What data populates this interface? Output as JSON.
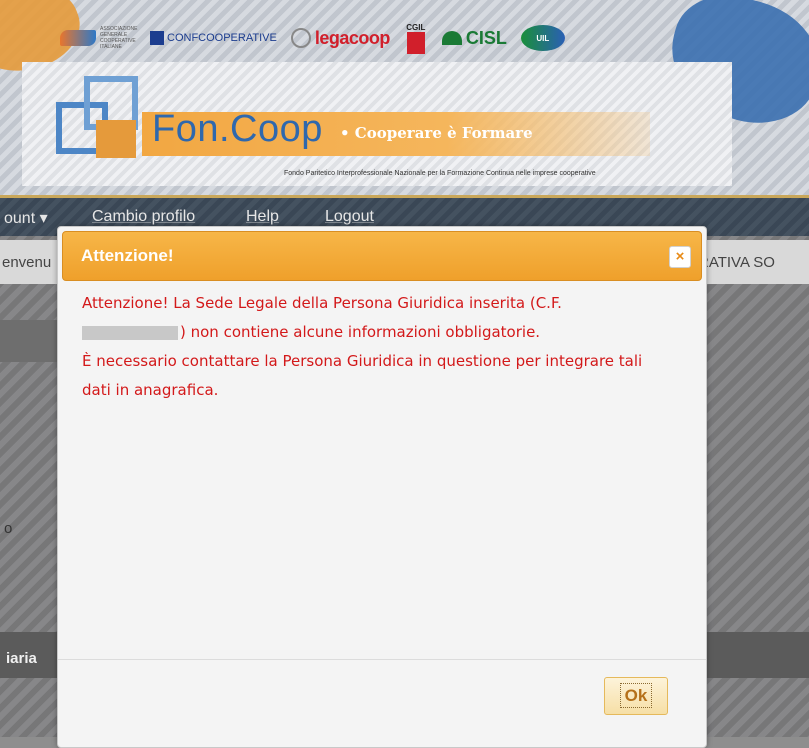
{
  "header": {
    "logos": {
      "anc_text": "ASSOCIAZIONE GENERALE COOPERATIVE ITALIANE",
      "confcooperative": "CONFCOOPERATIVE",
      "legacoop": "legacoop",
      "cgil": "CGIL",
      "cisl": "CISL",
      "uil": "UIL"
    },
    "brand": {
      "name": "Fon.Coop",
      "tagline": "• Cooperare è Formare",
      "subtitle": "Fondo Paritetico Interprofessionale Nazionale per la Formazione Continua nelle imprese cooperative"
    }
  },
  "navbar": {
    "items": [
      {
        "label": "ount ▾"
      },
      {
        "label": "Cambio profilo"
      },
      {
        "label": "Help"
      },
      {
        "label": "Logout"
      }
    ]
  },
  "background_page": {
    "welcome_left": "envenu",
    "welcome_right": "ERATIVA SO",
    "side_letter": "o",
    "section_label": "iaria"
  },
  "modal": {
    "title": "Attenzione!",
    "close_symbol": "×",
    "line1": "Attenzione! La Sede Legale della Persona Giuridica inserita (C.F.",
    "line2_after_redaction": ") non contiene alcune informazioni obbligatorie.",
    "line3": "È necessario contattare la Persona Giuridica in questione per integrare tali",
    "line4": "dati in anagrafica.",
    "ok_label": "Ok"
  },
  "colors": {
    "modal_header": "#f0a52e",
    "error_text": "#d3191a",
    "navbar": "#3d4b5a",
    "brand_blue": "#2f68ad"
  }
}
